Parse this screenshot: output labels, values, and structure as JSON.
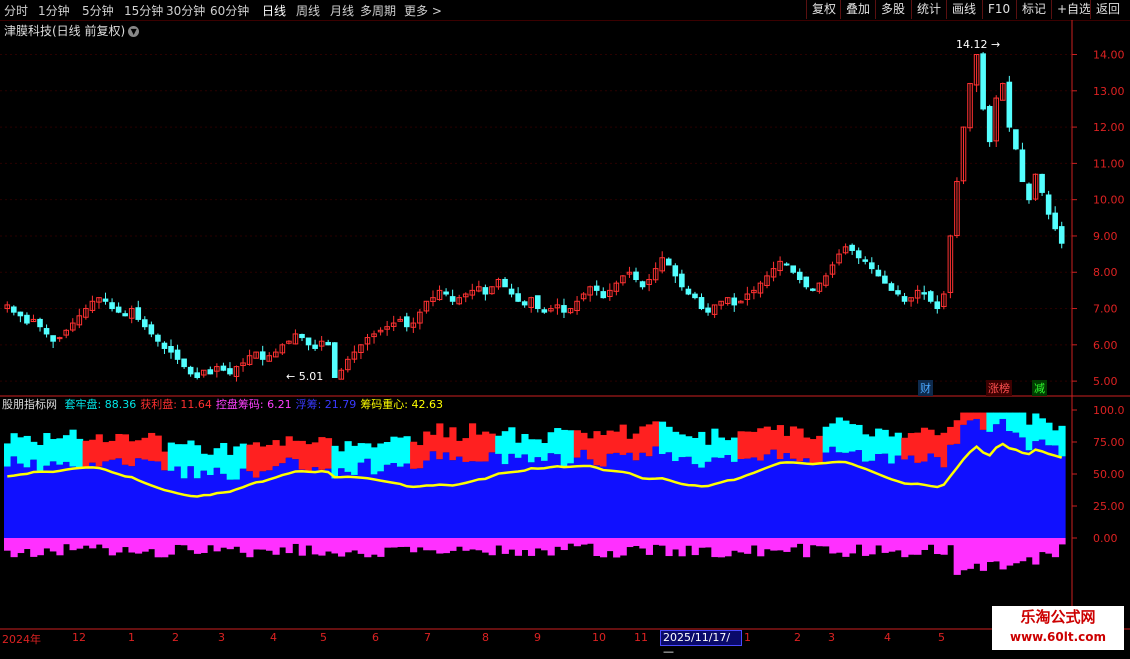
{
  "toolbar": {
    "timeframes": [
      "分时",
      "1分钟",
      "5分钟",
      "15分钟",
      "30分钟",
      "60分钟",
      "日线",
      "周线",
      "月线",
      "多周期",
      "更多 >"
    ],
    "active_timeframe": "日线",
    "buttons": [
      "复权",
      "叠加",
      "多股",
      "统计",
      "画线",
      "F10",
      "标记",
      "+自选",
      "返回"
    ]
  },
  "stock_title": "津膜科技(日线 前复权)",
  "price_axis": [
    "14.00",
    "13.00",
    "12.00",
    "11.00",
    "10.00",
    "9.00",
    "8.00",
    "7.00",
    "6.00",
    "5.00"
  ],
  "annotations": {
    "high": "14.12",
    "low": "5.01"
  },
  "event_tags": {
    "finance": "财",
    "limit_up_list": "涨榜",
    "reduce": "减"
  },
  "indicator": {
    "name": "股朋指标网",
    "items": [
      {
        "label": "套牢盘:",
        "value": "88.36",
        "color": "#00e5e5"
      },
      {
        "label": "获利盘:",
        "value": "11.64",
        "color": "#ff3030"
      },
      {
        "label": "控盘筹码:",
        "value": "6.21",
        "color": "#ff40ff"
      },
      {
        "label": "浮筹:",
        "value": "21.79",
        "color": "#3a3aff"
      },
      {
        "label": "筹码重心:",
        "value": "42.63",
        "color": "#ffff00"
      }
    ],
    "axis": [
      "100.0",
      "75.00",
      "50.00",
      "25.00",
      "0.00"
    ]
  },
  "date_axis": [
    "2024年",
    "12",
    "1",
    "2",
    "3",
    "4",
    "5",
    "6",
    "7",
    "8",
    "9",
    "10",
    "11",
    "1",
    "2",
    "3",
    "4",
    "5"
  ],
  "cursor_date": "2025/11/17/—",
  "watermark": {
    "line1": "乐淘公式网",
    "line2": "www.60lt.com"
  },
  "colors": {
    "up": "#ff3232",
    "down": "#54ffff",
    "trapped": "#00ffff",
    "profit": "#ff2020",
    "control": "#ff30ff",
    "float": "#1010ff",
    "center": "#ffff00",
    "axis": "#cc2020"
  },
  "chart_data": {
    "type": "candlestick",
    "price_range": [
      4.7,
      14.4
    ],
    "closes": [
      7.1,
      6.9,
      6.8,
      6.6,
      6.7,
      6.5,
      6.3,
      6.1,
      6.2,
      6.4,
      6.6,
      6.8,
      7.0,
      7.2,
      7.3,
      7.2,
      7.0,
      6.9,
      6.8,
      7.0,
      6.7,
      6.5,
      6.3,
      6.1,
      5.9,
      5.8,
      5.6,
      5.4,
      5.2,
      5.1,
      5.3,
      5.2,
      5.4,
      5.3,
      5.2,
      5.4,
      5.5,
      5.7,
      5.8,
      5.6,
      5.7,
      5.8,
      6.0,
      6.1,
      6.3,
      6.2,
      6.0,
      5.9,
      6.1,
      6.0,
      5.1,
      5.3,
      5.6,
      5.8,
      6.0,
      6.2,
      6.3,
      6.4,
      6.5,
      6.6,
      6.7,
      6.5,
      6.6,
      6.9,
      7.2,
      7.3,
      7.5,
      7.4,
      7.2,
      7.3,
      7.4,
      7.5,
      7.6,
      7.4,
      7.6,
      7.8,
      7.6,
      7.4,
      7.2,
      7.1,
      7.3,
      7.0,
      6.9,
      7.0,
      7.1,
      6.9,
      7.0,
      7.2,
      7.4,
      7.6,
      7.5,
      7.3,
      7.5,
      7.7,
      7.9,
      8.0,
      7.8,
      7.6,
      7.8,
      8.1,
      8.4,
      8.2,
      7.9,
      7.6,
      7.4,
      7.3,
      7.0,
      6.9,
      7.1,
      7.2,
      7.3,
      7.1,
      7.2,
      7.4,
      7.5,
      7.7,
      7.9,
      8.1,
      8.3,
      8.2,
      8.0,
      7.8,
      7.6,
      7.5,
      7.7,
      7.9,
      8.2,
      8.5,
      8.7,
      8.6,
      8.4,
      8.3,
      8.1,
      7.9,
      7.7,
      7.5,
      7.4,
      7.2,
      7.3,
      7.5,
      7.4,
      7.2,
      7.0,
      7.4,
      9.0,
      10.5,
      12.0,
      13.2,
      14.0,
      12.5,
      11.6,
      12.8,
      13.2,
      12.0,
      11.4,
      10.5,
      10.0,
      10.7,
      10.2,
      9.6,
      9.2,
      8.8
    ]
  }
}
